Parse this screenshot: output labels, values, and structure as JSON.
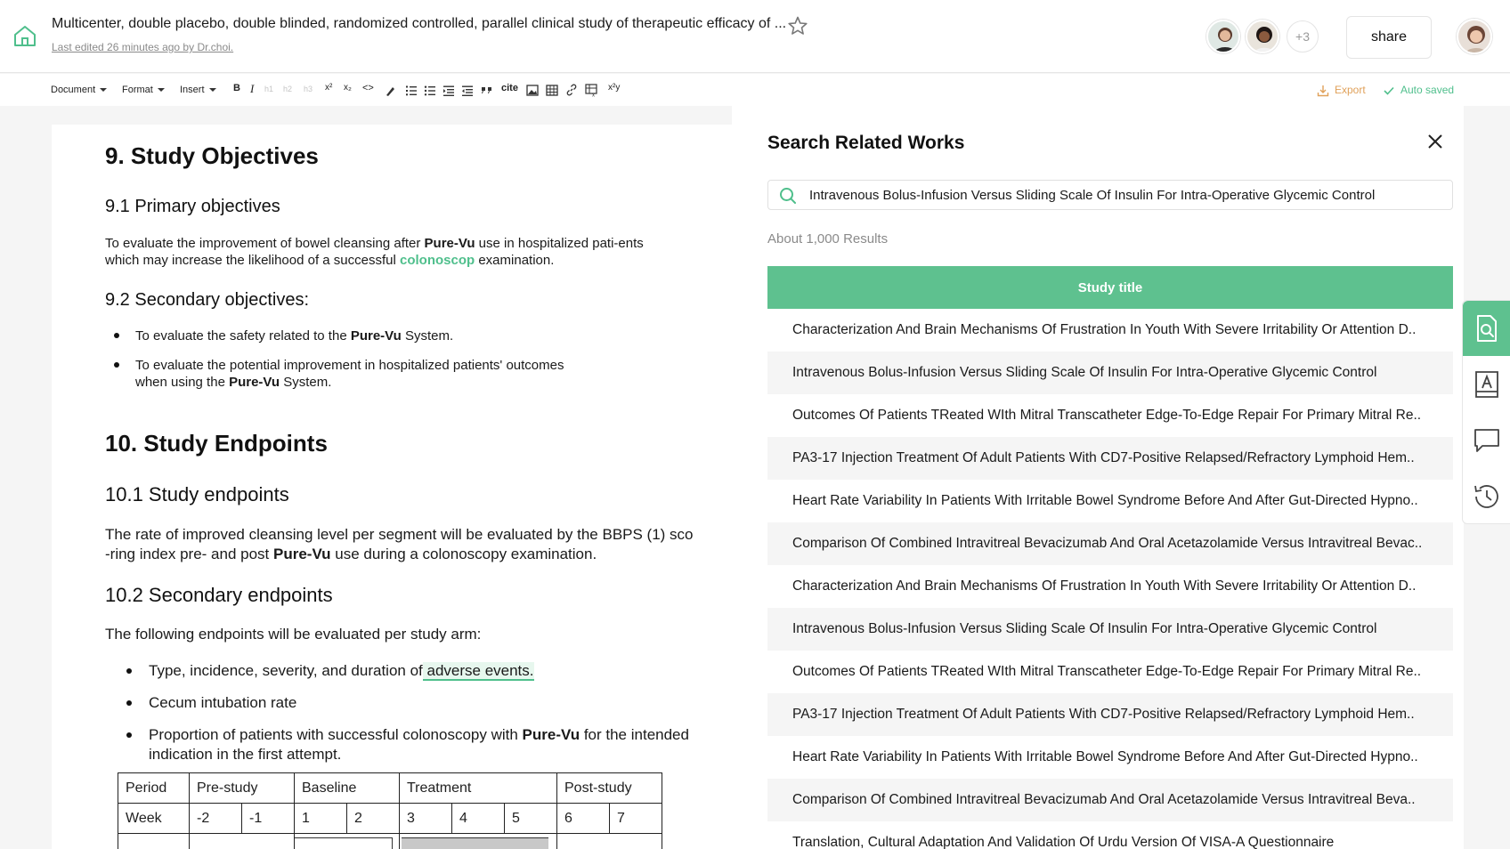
{
  "header": {
    "doc_title": "Multicenter, double placebo, double blinded, randomized controlled, parallel clinical study of therapeutic efficacy of ...",
    "last_edited": "Last edited 26 minutes ago by Dr.choi.",
    "more_users": "+3",
    "share_label": "share"
  },
  "toolbar": {
    "menus": [
      "Document",
      "Format",
      "Insert"
    ],
    "tools": [
      "B",
      "I",
      "h1",
      "h2",
      "h3",
      "x²",
      "x₂",
      "<>",
      "cite",
      "x²y"
    ],
    "export_label": "Export",
    "saved_label": "Auto saved"
  },
  "document": {
    "sec9_title": "9. Study Objectives",
    "sec91_title": "9.1 Primary objectives",
    "sec91_p1_a": "To evaluate the improvement of bowel cleansing after ",
    "brand": "Pure-Vu",
    "sec91_p1_b": " use in hospitalized pati-ents",
    "sec91_p2_a": "which may increase the likelihood of a successful ",
    "sec91_link": "colonoscop",
    "sec91_p2_b": " examination.",
    "sec92_title": "9.2 Secondary objectives:",
    "sec92_b1_a": "To evaluate the safety related to the ",
    "sec92_b1_b": " System.",
    "sec92_b2_a": "To evaluate the potential improvement in hospitalized patients' outcomes",
    "sec92_b2_b": "when using the ",
    "sec92_b2_c": " System.",
    "sec10_title": "10. Study Endpoints",
    "sec101_title": "10.1 Study endpoints",
    "sec101_p1": "The rate of improved cleansing level per segment will be evaluated by the BBPS (1) sco",
    "sec101_p2_a": "-ring index pre- and post ",
    "sec101_p2_b": " use during a colonoscopy examination.",
    "sec102_title": "10.2 Secondary endpoints",
    "sec102_intro": "The following endpoints will be evaluated per study arm:",
    "sec102_b1_a": "Type, incidence, severity, and duration of",
    "sec102_b1_hl": " adverse events.",
    "sec102_b2": "Cecum intubation rate",
    "sec102_b3_a": "Proportion of patients with successful colonoscopy with ",
    "sec102_b3_b": " for the intended",
    "sec102_b3_c": "indication in the first attempt.",
    "table": {
      "row1": [
        "Period",
        "Pre-study",
        "Baseline",
        "Treatment",
        "Post-study"
      ],
      "row2": [
        "Week",
        "-2",
        "-1",
        "1",
        "2",
        "3",
        "4",
        "5",
        "6",
        "7"
      ]
    }
  },
  "panel": {
    "title": "Search Related Works",
    "search_value": "Intravenous Bolus-Infusion Versus Sliding Scale Of Insulin For Intra-Operative Glycemic Control",
    "results_count": "About 1,000 Results",
    "column_header": "Study title",
    "results": [
      "Characterization And Brain Mechanisms Of Frustration In Youth With Severe Irritability Or Attention D..",
      "Intravenous Bolus-Infusion Versus Sliding Scale Of Insulin For Intra-Operative Glycemic Control",
      "Outcomes Of Patients TReated WIth Mitral Transcatheter Edge-To-Edge Repair For Primary Mitral Re..",
      "PA3-17 Injection Treatment Of Adult Patients With CD7-Positive Relapsed/Refractory Lymphoid Hem..",
      "Heart Rate Variability In Patients With Irritable Bowel Syndrome Before And After Gut-Directed Hypno..",
      "Comparison Of Combined Intravitreal Bevacizumab And Oral Acetazolamide Versus Intravitreal Bevac..",
      "Characterization And Brain Mechanisms Of Frustration In Youth With Severe Irritability Or Attention D..",
      "Intravenous Bolus-Infusion Versus Sliding Scale Of Insulin For Intra-Operative Glycemic Control",
      "Outcomes Of Patients TReated WIth Mitral Transcatheter Edge-To-Edge Repair For Primary Mitral Re..",
      "PA3-17 Injection Treatment Of Adult Patients With CD7-Positive Relapsed/Refractory Lymphoid Hem..",
      "Heart Rate Variability In Patients With Irritable Bowel Syndrome Before And After Gut-Directed Hypno..",
      "Comparison Of Combined Intravitreal Bevacizumab And Oral Acetazolamide Versus Intravitreal Beva..",
      "Translation, Cultural Adaptation And Validation Of Urdu Version Of VISA-A Questionnaire"
    ]
  },
  "rail": {
    "icons": [
      "search-document-icon",
      "text-style-icon",
      "comment-icon",
      "history-icon"
    ]
  },
  "colors": {
    "accent": "#5ec18f",
    "accent_text": "#4fbf8c",
    "export": "#e0a15a"
  }
}
